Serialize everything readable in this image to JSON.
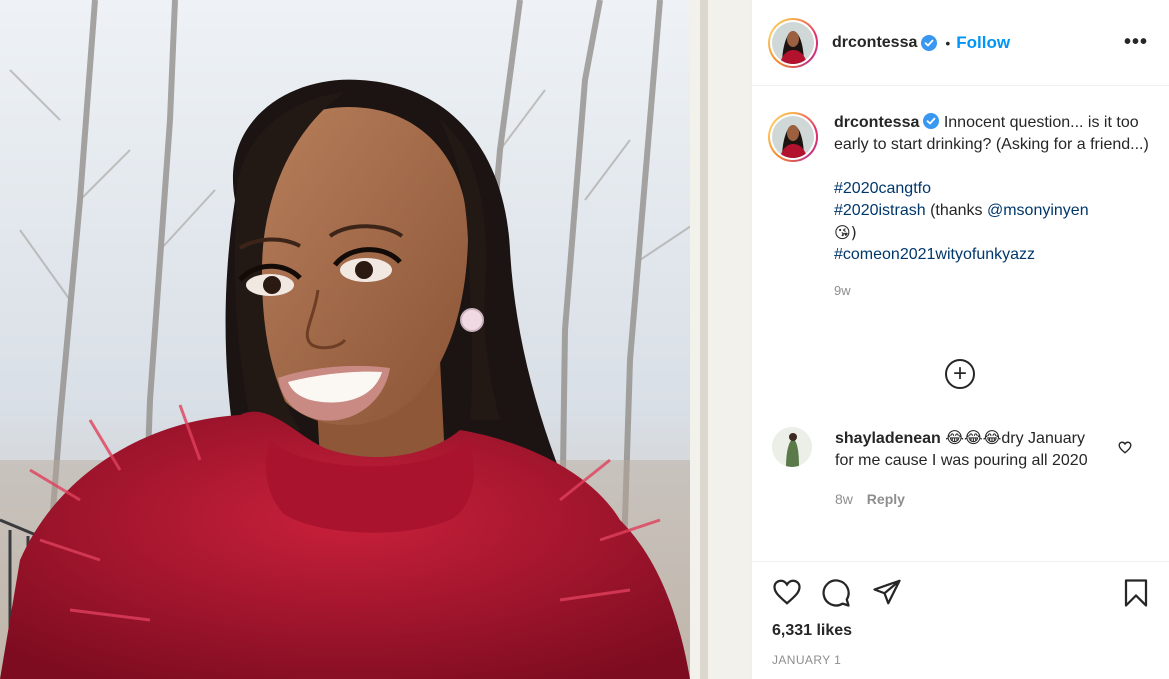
{
  "post": {
    "username": "drcontessa",
    "follow_label": "Follow",
    "separator": "•",
    "more_label": "•••"
  },
  "caption": {
    "username": "drcontessa",
    "text": "Innocent question... is it too early to start drinking? (Asking for a friend...)",
    "hashtag1": "#2020cangtfo",
    "hashtag2": "#2020istrash",
    "thanks_prefix": " (thanks ",
    "mention": "@msonyinyen",
    "emoji_line": "😘)",
    "hashtag3": "#comeon2021wityofunkyazz",
    "age": "9w"
  },
  "load_more": "+",
  "comment": {
    "username": "shayladenean",
    "emojis": "😂😂😂",
    "text": "dry January for me cause I was pouring all 2020",
    "age": "8w",
    "reply_label": "Reply"
  },
  "footer": {
    "likes": "6,331 likes",
    "date": "JANUARY 1"
  },
  "icons": [
    "verified-icon",
    "more-icon",
    "add-comment-icon",
    "heart-icon",
    "comment-icon",
    "share-icon",
    "save-icon"
  ],
  "colors": {
    "follow": "#0095f6",
    "link": "#00376b",
    "muted": "#8e8e8e",
    "verified": "#3897f0"
  }
}
